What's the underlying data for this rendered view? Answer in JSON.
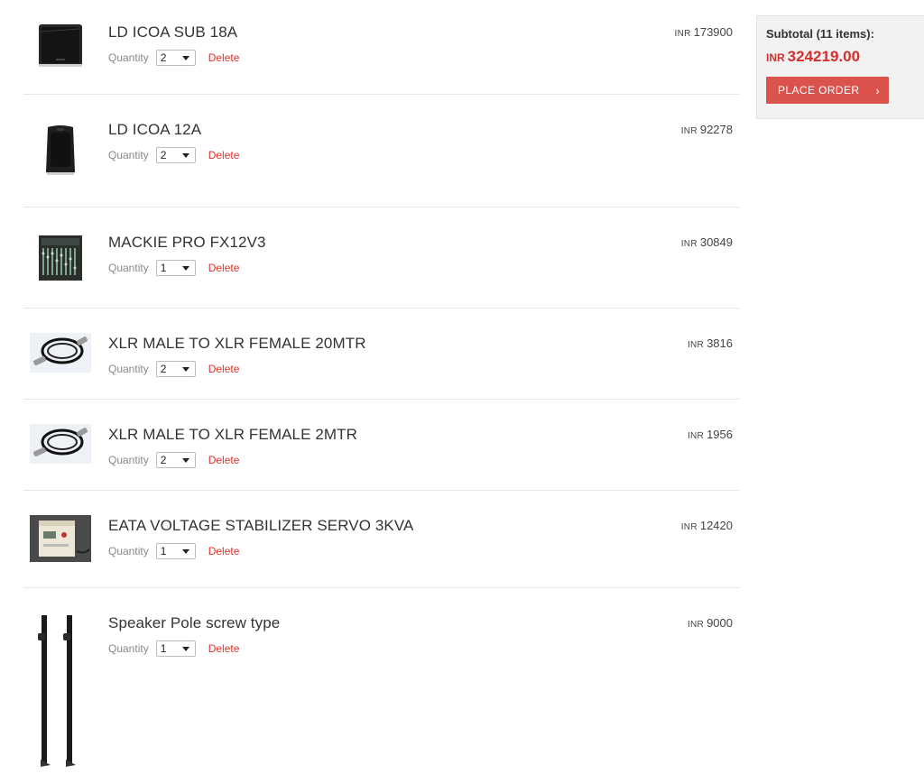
{
  "cart": {
    "quantity_label": "Quantity",
    "delete_label": "Delete",
    "currency": "INR",
    "items": [
      {
        "name": "LD ICOA SUB 18A",
        "quantity": "2",
        "price": "173900",
        "thumb_icon": "subwoofer-icon"
      },
      {
        "name": "LD ICOA 12A",
        "quantity": "2",
        "price": "92278",
        "thumb_icon": "speaker-icon"
      },
      {
        "name": "MACKIE PRO FX12V3",
        "quantity": "1",
        "price": "30849",
        "thumb_icon": "mixer-icon"
      },
      {
        "name": "XLR MALE TO XLR FEMALE 20MTR",
        "quantity": "2",
        "price": "3816",
        "thumb_icon": "cable-icon"
      },
      {
        "name": "XLR MALE TO XLR FEMALE 2MTR",
        "quantity": "2",
        "price": "1956",
        "thumb_icon": "cable-icon"
      },
      {
        "name": "EATA VOLTAGE STABILIZER SERVO 3KVA",
        "quantity": "1",
        "price": "12420",
        "thumb_icon": "stabilizer-icon"
      },
      {
        "name": "Speaker Pole screw type",
        "quantity": "1",
        "price": "9000",
        "thumb_icon": "speaker-pole-icon"
      }
    ]
  },
  "summary": {
    "subtotal_label": "Subtotal (11 items):",
    "currency": "INR",
    "amount": "324219.00",
    "place_order_label": "PLACE ORDER",
    "chevron_glyph": "›"
  },
  "colors": {
    "accent": "#db524c",
    "price_red": "#d32f2f",
    "delete_red": "#d9362f",
    "panel_bg": "#f2f2f2"
  }
}
